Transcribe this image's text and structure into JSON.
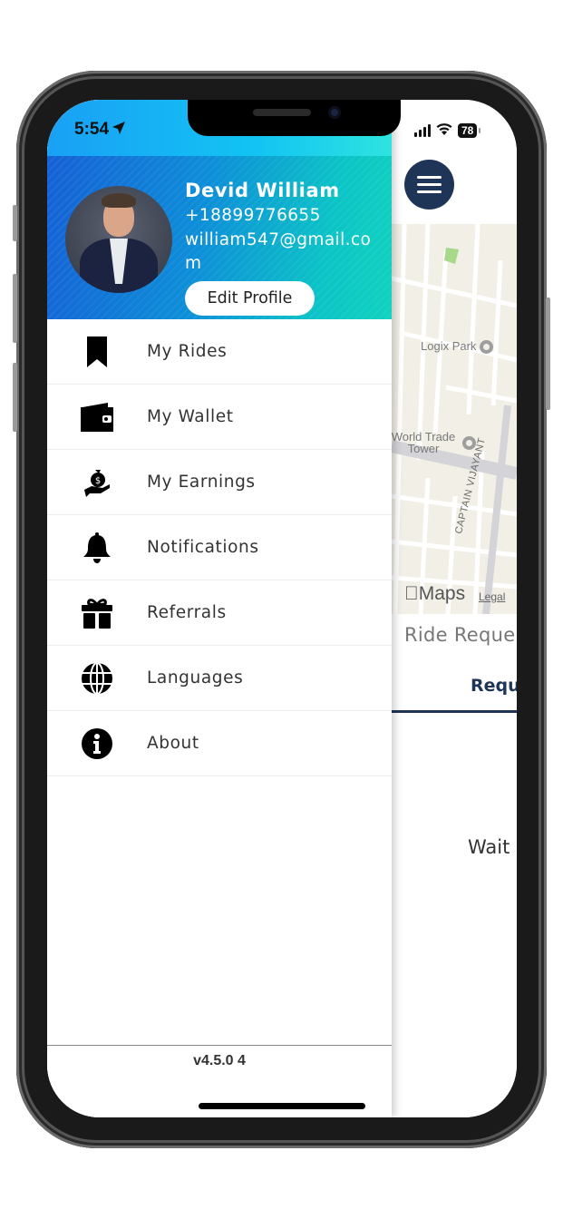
{
  "status_bar": {
    "time": "5:54",
    "battery": "78"
  },
  "drawer": {
    "user": {
      "name": "Devid William",
      "phone": "+18899776655",
      "email": "william547@gmail.com",
      "edit_label": "Edit Profile"
    },
    "menu": [
      {
        "icon": "bookmark-icon",
        "label": "My Rides"
      },
      {
        "icon": "wallet-icon",
        "label": "My Wallet"
      },
      {
        "icon": "money-bag-hand-icon",
        "label": "My Earnings"
      },
      {
        "icon": "bell-icon",
        "label": "Notifications"
      },
      {
        "icon": "gift-icon",
        "label": "Referrals"
      },
      {
        "icon": "globe-icon",
        "label": "Languages"
      },
      {
        "icon": "info-icon",
        "label": "About"
      }
    ],
    "version": "v4.5.0 4"
  },
  "background_app": {
    "map": {
      "labels": [
        "Logix Park",
        "World Trade Tower",
        "CAPTAIN VIJAYANT"
      ],
      "brand": "Maps",
      "legal": "Legal"
    },
    "ride_title": "Ride Reque",
    "tab_label": "Requ",
    "waiting_text": "Wait"
  },
  "colors": {
    "primary": "#1f3558",
    "header_start": "#1560d6",
    "header_end": "#10d3bf"
  }
}
